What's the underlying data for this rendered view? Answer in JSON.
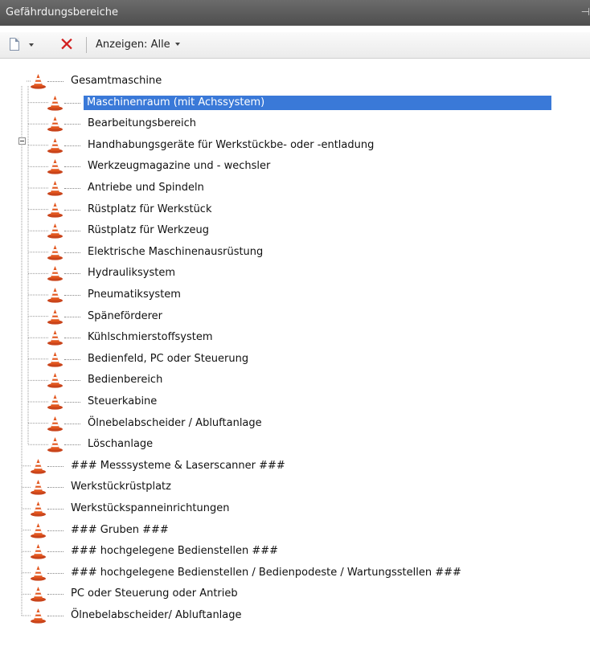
{
  "panel": {
    "title": "Gefährdungsbereiche",
    "pin_glyph": "⊣"
  },
  "toolbar": {
    "show_label": "Anzeigen: Alle",
    "delete_glyph": "✕"
  },
  "tree": {
    "root": {
      "label": "Gesamtmaschine",
      "expanded": true,
      "children": [
        {
          "label": "Maschinenraum (mit Achssystem)",
          "selected": true
        },
        {
          "label": "Bearbeitungsbereich"
        },
        {
          "label": "Handhabungsgeräte für Werkstückbe- oder -entladung"
        },
        {
          "label": "Werkzeugmagazine und - wechsler"
        },
        {
          "label": "Antriebe und Spindeln"
        },
        {
          "label": "Rüstplatz für Werkstück"
        },
        {
          "label": "Rüstplatz für Werkzeug"
        },
        {
          "label": "Elektrische Maschinenausrüstung"
        },
        {
          "label": "Hydrauliksystem"
        },
        {
          "label": "Pneumatiksystem"
        },
        {
          "label": "Späneförderer"
        },
        {
          "label": "Kühlschmierstoffsystem"
        },
        {
          "label": "Bedienfeld, PC oder Steuerung"
        },
        {
          "label": "Bedienbereich"
        },
        {
          "label": "Steuerkabine"
        },
        {
          "label": "Ölnebelabscheider / Abluftanlage"
        },
        {
          "label": "Löschanlage"
        }
      ]
    },
    "top_items": [
      {
        "label": "### Messsysteme & Laserscanner ###"
      },
      {
        "label": "Werkstückrüstplatz"
      },
      {
        "label": "Werkstückspanneinrichtungen"
      },
      {
        "label": "### Gruben ###"
      },
      {
        "label": "### hochgelegene Bedienstellen ###"
      },
      {
        "label": "### hochgelegene Bedienstellen / Bedienpodeste / Wartungsstellen ###"
      },
      {
        "label": "PC oder Steuerung oder Antrieb"
      },
      {
        "label": "Ölnebelabscheider/ Abluftanlage"
      }
    ]
  },
  "colors": {
    "selection": "#3a79d8",
    "cone_orange": "#e2561e",
    "delete_red": "#d21f1f"
  },
  "icons": {
    "node_icon": "traffic-cone-icon"
  }
}
